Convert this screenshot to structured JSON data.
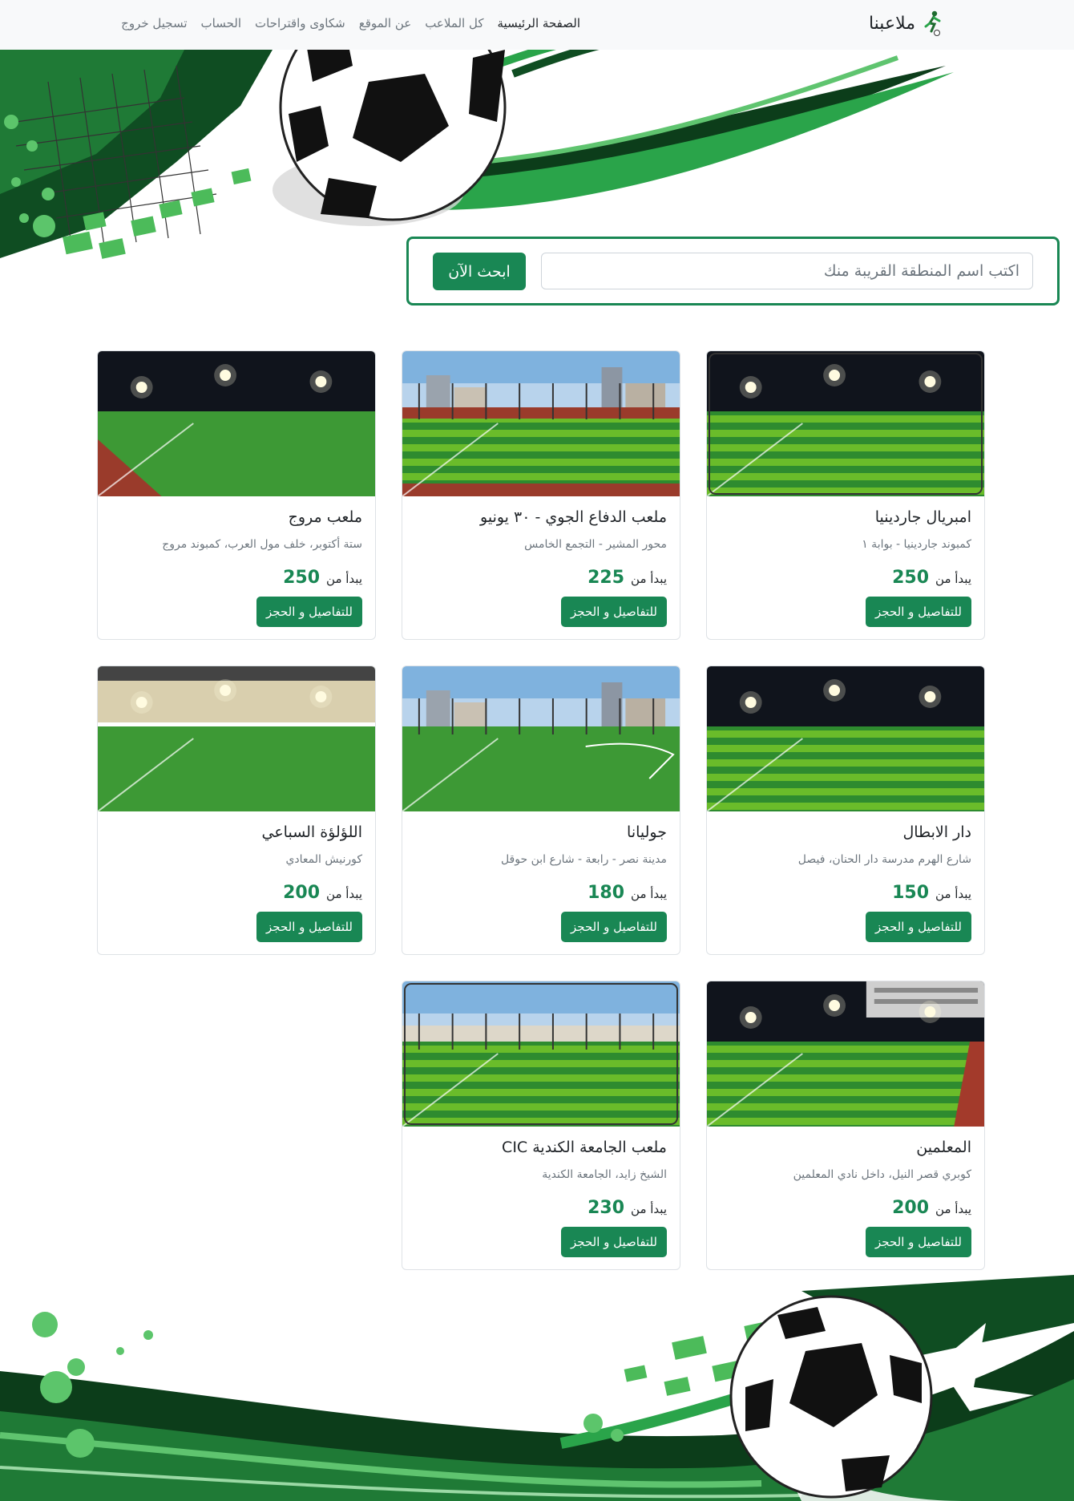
{
  "nav": {
    "brand": "ملاعبنا",
    "links": [
      "الصفحة الرئيسية",
      "كل الملاعب",
      "عن الموقع",
      "شكاوى واقتراحات",
      "الحساب",
      "تسجيل خروج"
    ]
  },
  "search": {
    "placeholder": "اكتب اسم المنطقة القريبة منك",
    "button": "ابحث الآن"
  },
  "cards": [
    {
      "title": "امبريال جاردينيا",
      "subtitle": "كمبوند جاردينيا - بوابة ١",
      "price_label": "يبدأ من",
      "price": "250",
      "button": "للتفاصيل و الحجز",
      "scene": "night-striped-framed"
    },
    {
      "title": "ملعب الدفاع الجوي - ٣٠ يونيو",
      "subtitle": "محور المشير - التجمع الخامس",
      "price_label": "يبدأ من",
      "price": "225",
      "button": "للتفاصيل و الحجز",
      "scene": "day-fenced"
    },
    {
      "title": "ملعب مروج",
      "subtitle": "ستة أكتوبر، خلف مول العرب، كمبوند مروج",
      "price_label": "يبدأ من",
      "price": "250",
      "button": "للتفاصيل و الحجز",
      "scene": "night-track"
    },
    {
      "title": "دار الابطال",
      "subtitle": "شارع الهرم مدرسة دار الحنان، فيصل",
      "price_label": "يبدأ من",
      "price": "150",
      "button": "للتفاصيل و الحجز",
      "scene": "night-striped"
    },
    {
      "title": "جوليانا",
      "subtitle": "مدينة نصر - رابعة - شارع ابن حوقل",
      "price_label": "يبدأ من",
      "price": "180",
      "button": "للتفاصيل و الحجز",
      "scene": "day-city"
    },
    {
      "title": "اللؤلؤة السباعي",
      "subtitle": "كورنيش المعادي",
      "price_label": "يبدأ من",
      "price": "200",
      "button": "للتفاصيل و الحجز",
      "scene": "indoor"
    },
    {
      "title": "المعلمين",
      "subtitle": "كوبري قصر النيل، داخل نادي المعلمين",
      "price_label": "يبدأ من",
      "price": "200",
      "button": "للتفاصيل و الحجز",
      "scene": "night-building"
    },
    {
      "title": "ملعب الجامعة الكندية CIC",
      "subtitle": "الشيخ زايد، الجامعة الكندية",
      "price_label": "يبدأ من",
      "price": "230",
      "button": "للتفاصيل و الحجز",
      "scene": "day-striped-framed"
    }
  ],
  "colors": {
    "accent": "#198754",
    "nav_bg": "#f8f9fa"
  }
}
